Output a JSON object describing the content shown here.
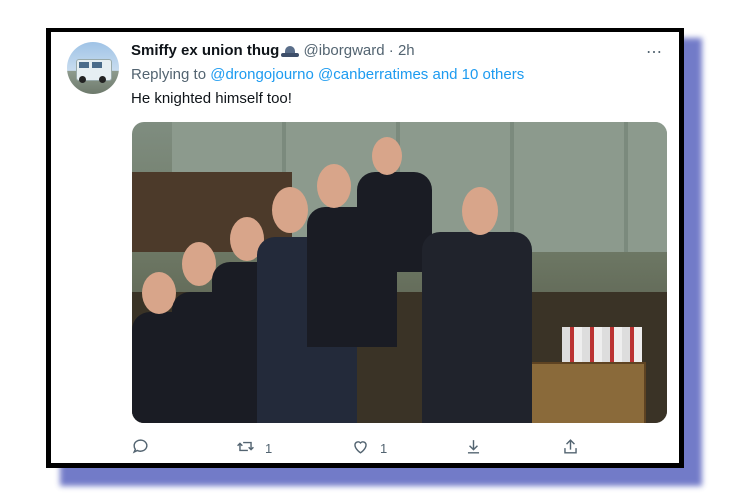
{
  "tweet": {
    "display_name": "Smiffy ex union thug",
    "handle": "@iborgward",
    "separator": "·",
    "time": "2h",
    "replying_to_prefix": "Replying to",
    "replying_to_user1": "@drongojourno",
    "replying_to_user2": "@canberratimes",
    "replying_to_rest": "and 10 others",
    "text": "He knighted himself too!",
    "more_icon": "⋯"
  },
  "actions": {
    "reply_icon": "reply-icon",
    "retweet_icon": "retweet-icon",
    "retweet_count": "1",
    "like_icon": "heart-icon",
    "like_count": "1",
    "save_icon": "download-icon",
    "share_icon": "share-icon"
  },
  "colors": {
    "link": "#1d9bf0",
    "secondary": "#536471",
    "frame_shadow": "#5a64bf"
  }
}
